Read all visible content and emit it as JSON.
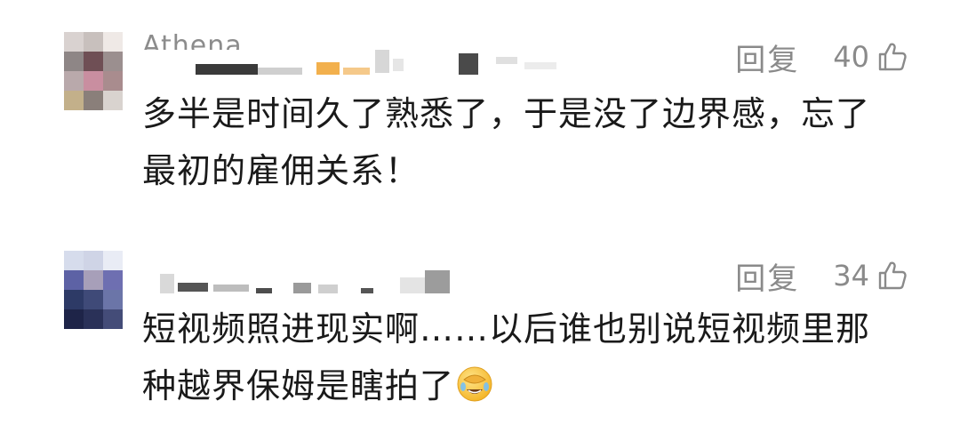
{
  "comments": [
    {
      "username": "Athena",
      "reply_label": "回复",
      "likes": "40",
      "text_line1": "多半是时间久了熟悉了，于是没了边界感，忘了",
      "text_line2": "最初的雇佣关系！",
      "avatar_icon": "pixelated-avatar-icon",
      "like_icon": "thumbs-up-icon"
    },
    {
      "reply_label": "回复",
      "likes": "34",
      "text_line1": "短视频照进现实啊……以后谁也别说短视频里那",
      "text_line2": "种越界保姆是瞎拍了",
      "emoji": "facepalm-laughing-emoji",
      "avatar_icon": "pixelated-avatar-icon",
      "like_icon": "thumbs-up-icon"
    }
  ]
}
